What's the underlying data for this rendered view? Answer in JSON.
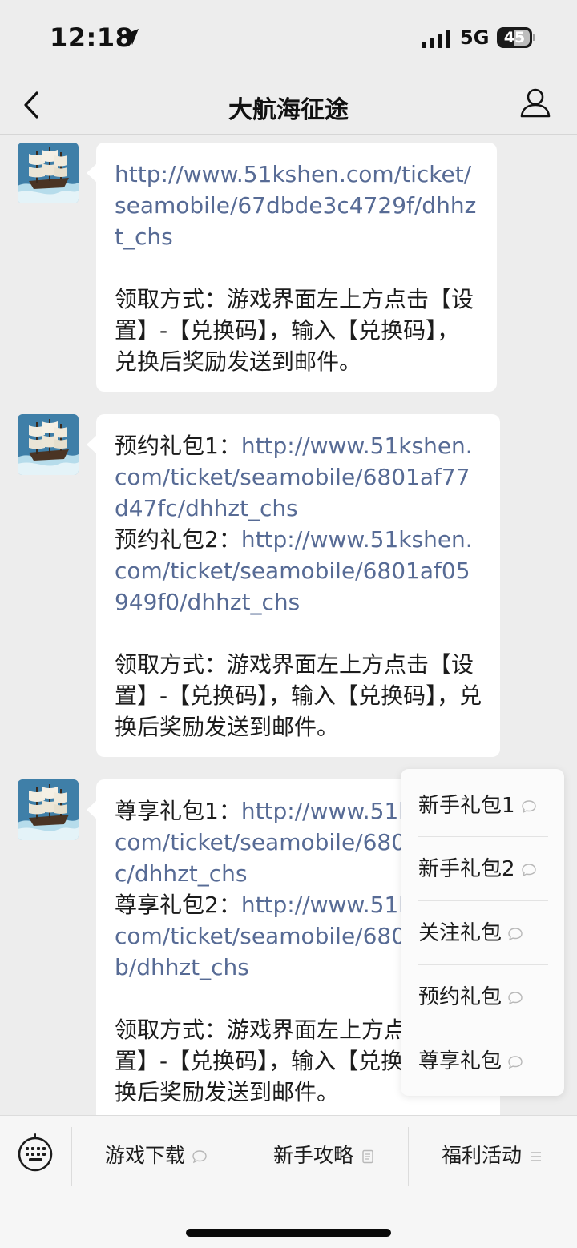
{
  "status_bar": {
    "time": "12:18",
    "network": "5G",
    "battery": "45"
  },
  "header": {
    "title": "大航海征途"
  },
  "messages": [
    {
      "link1": "http://www.51kshen.com/ticket/seamobile/67dbde3c4729f/dhhzt_chs",
      "instructions": "领取方式：游戏界面左上方点击【设置】-【兑换码】，输入【兑换码】，兑换后奖励发送到邮件。"
    },
    {
      "label1": "预约礼包1：",
      "link1": "http://www.51kshen.com/ticket/seamobile/6801af77d47fc/dhhzt_chs",
      "label2": "预约礼包2：",
      "link2": "http://www.51kshen.com/ticket/seamobile/6801af05949f0/dhhzt_chs",
      "instructions": "领取方式：游戏界面左上方点击【设置】-【兑换码】，输入【兑换码】，兑换后奖励发送到邮件。"
    },
    {
      "label1": "尊享礼包1：",
      "link1": "http://www.51kshen.com/ticket/seamobile/6801af0ffc/dhhzt_chs",
      "label2": "尊享礼包2：",
      "link2": "http://www.51kshen.com/ticket/seamobile/680a4b3b/dhhzt_chs",
      "instructions": "领取方式：游戏界面左上方点击【设置】-【兑换码】，输入【兑换码】，兑换后奖励发送到邮件。"
    }
  ],
  "popup_menu": {
    "items": [
      {
        "label": "新手礼包1",
        "icon": "chat-bubble-icon"
      },
      {
        "label": "新手礼包2",
        "icon": "chat-bubble-icon"
      },
      {
        "label": "关注礼包",
        "icon": "chat-bubble-icon"
      },
      {
        "label": "预约礼包",
        "icon": "chat-bubble-icon"
      },
      {
        "label": "尊享礼包",
        "icon": "chat-bubble-icon"
      }
    ]
  },
  "bottom_menu": {
    "keyboard_icon": "keyboard-icon",
    "items": [
      {
        "label": "游戏下载",
        "icon": "chat-bubble-icon"
      },
      {
        "label": "新手攻略",
        "icon": "document-icon"
      },
      {
        "label": "福利活动",
        "icon": "menu-lines-icon"
      }
    ]
  },
  "colors": {
    "background": "#ededed",
    "link": "#576b95",
    "bubble": "#ffffff"
  }
}
